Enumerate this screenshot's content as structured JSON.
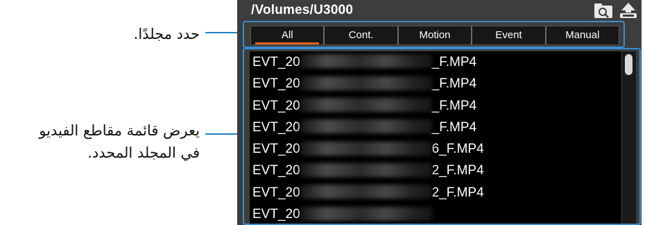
{
  "annotations": {
    "select_folder": "حدد مجلدًا.",
    "video_list_line1": "يعرض قائمة مقاطع الفيديو",
    "video_list_line2": "في المجلد المحدد."
  },
  "header": {
    "path": "/Volumes/U3000",
    "icons": [
      "folder-search-icon",
      "eject-icon"
    ]
  },
  "tabs": [
    {
      "label": "All",
      "active": true
    },
    {
      "label": "Cont.",
      "active": false
    },
    {
      "label": "Motion",
      "active": false
    },
    {
      "label": "Event",
      "active": false
    },
    {
      "label": "Manual",
      "active": false
    }
  ],
  "files": [
    {
      "prefix": "EVT_20",
      "suffix": "_F.MP4"
    },
    {
      "prefix": "EVT_20",
      "suffix": "_F.MP4"
    },
    {
      "prefix": "EVT_20",
      "suffix": "_F.MP4"
    },
    {
      "prefix": "EVT_20",
      "suffix": "_F.MP4"
    },
    {
      "prefix": "EVT_20",
      "suffix": "6_F.MP4"
    },
    {
      "prefix": "EVT_20",
      "suffix": "2_F.MP4"
    },
    {
      "prefix": "EVT_20",
      "suffix": "2_F.MP4"
    },
    {
      "prefix": "EVT_20",
      "suffix": ""
    }
  ],
  "colors": {
    "callout_blue": "#1f7fbf",
    "active_tab_underline": "#e25b1e",
    "window_bg": "#3d3d3d"
  }
}
